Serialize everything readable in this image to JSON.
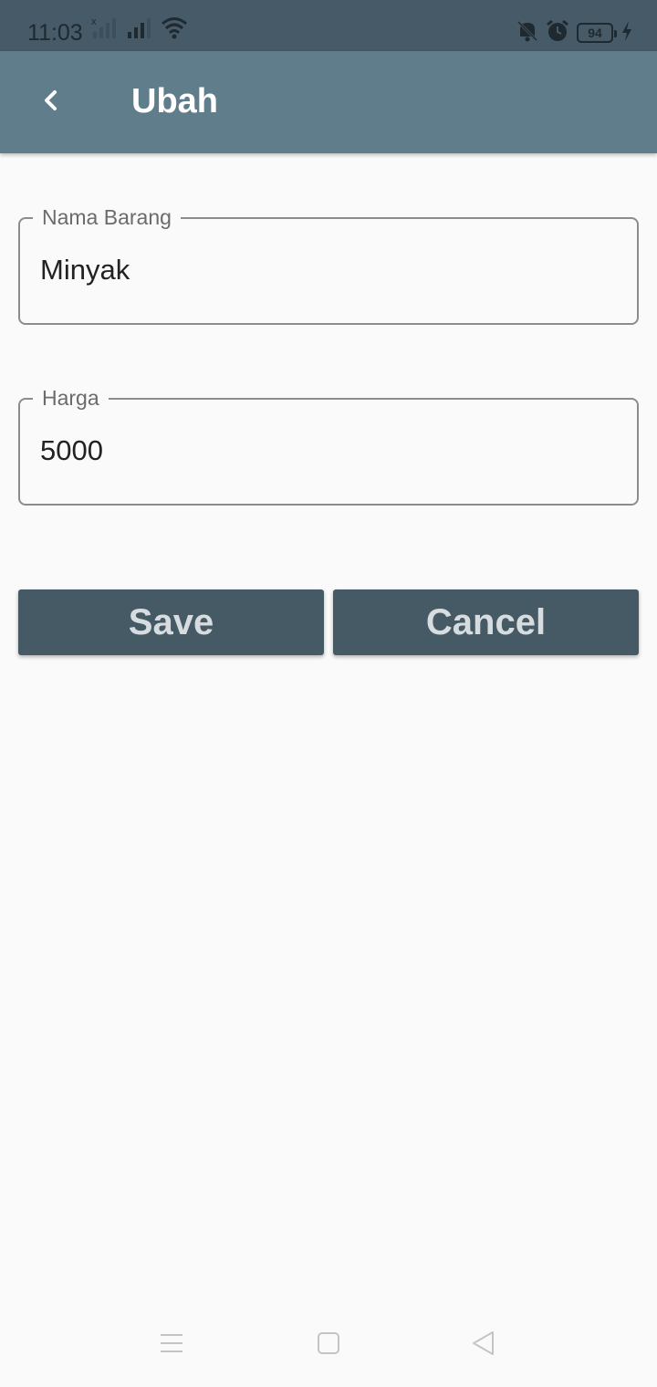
{
  "status_bar": {
    "time": "11:03",
    "battery_level": "94",
    "icons": [
      "sim-no-signal-icon",
      "signal-icon",
      "wifi-icon",
      "bell-off-icon",
      "alarm-icon",
      "battery-icon",
      "charging-icon"
    ]
  },
  "app_bar": {
    "title": "Ubah",
    "back_icon": "chevron-left-icon",
    "background_color": "#607d8b"
  },
  "form": {
    "nama_barang": {
      "label": "Nama Barang",
      "value": "Minyak"
    },
    "harga": {
      "label": "Harga",
      "value": "5000"
    }
  },
  "actions": {
    "save_label": "Save",
    "cancel_label": "Cancel",
    "button_color": "#455a64"
  },
  "nav_bar": {
    "icons": [
      "menu-icon",
      "home-icon",
      "back-triangle-icon"
    ]
  }
}
